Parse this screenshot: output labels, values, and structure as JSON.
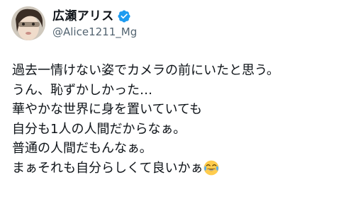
{
  "author": {
    "display_name": "広瀬アリス",
    "handle": "@Alice1211_Mg",
    "verified": true,
    "avatar_icon": "avatar-photo",
    "verified_icon": "verified-badge-icon",
    "verified_color": "#1d9bf0"
  },
  "tweet": {
    "lines": [
      "過去一情けない姿でカメラの前にいたと思う。",
      "うん、恥ずかしかった…",
      "華やかな世界に身を置いていても",
      "自分も1人の人間だからなぁ。",
      "普通の人間だもんなぁ。",
      "まぁそれも自分らしくて良いかぁ"
    ],
    "trailing_emoji": "face-with-tears-of-joy-icon"
  },
  "colors": {
    "text_primary": "#0f1419",
    "text_secondary": "#536471",
    "background": "#ffffff"
  }
}
